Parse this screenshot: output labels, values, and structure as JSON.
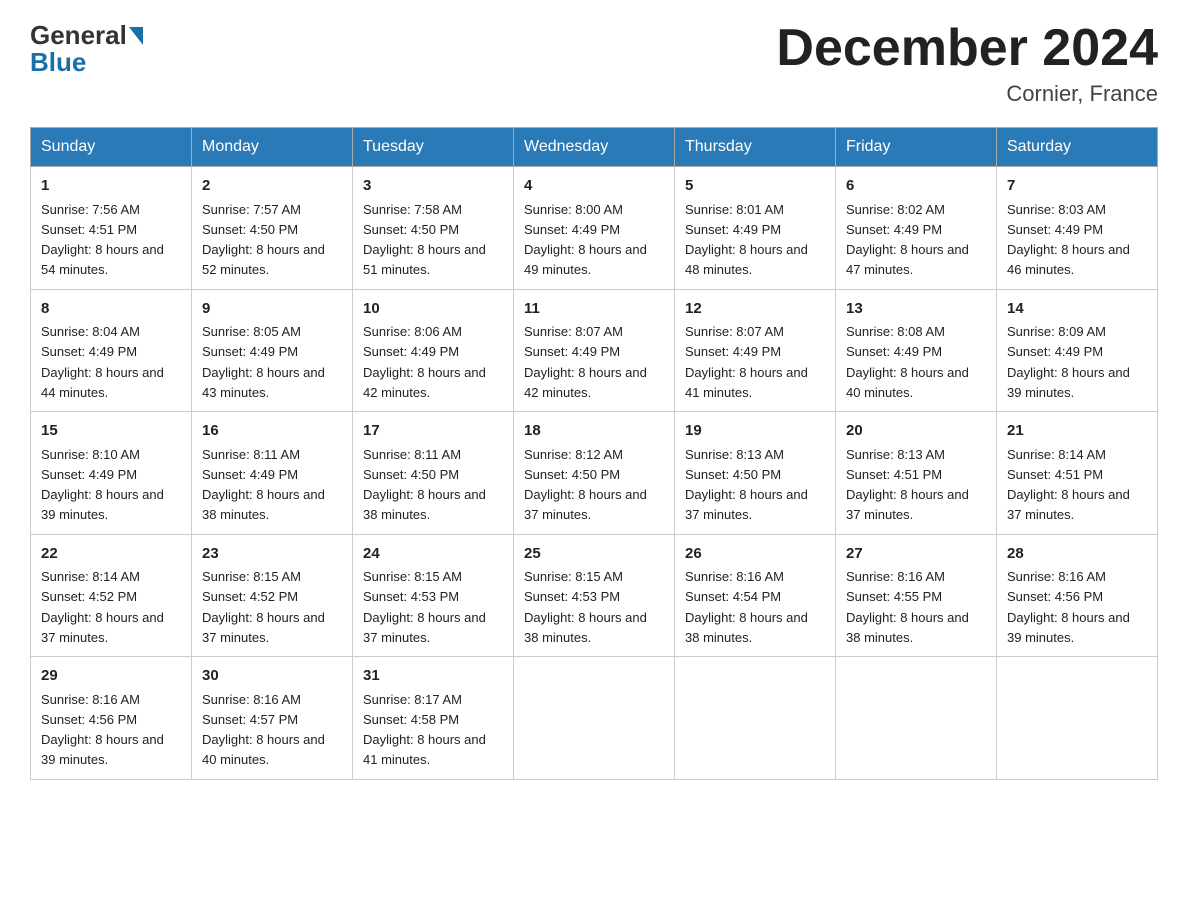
{
  "header": {
    "logo": {
      "general": "General",
      "blue": "Blue"
    },
    "title": "December 2024",
    "location": "Cornier, France"
  },
  "days_of_week": [
    "Sunday",
    "Monday",
    "Tuesday",
    "Wednesday",
    "Thursday",
    "Friday",
    "Saturday"
  ],
  "weeks": [
    [
      {
        "day": "1",
        "sunrise": "7:56 AM",
        "sunset": "4:51 PM",
        "daylight": "8 hours and 54 minutes."
      },
      {
        "day": "2",
        "sunrise": "7:57 AM",
        "sunset": "4:50 PM",
        "daylight": "8 hours and 52 minutes."
      },
      {
        "day": "3",
        "sunrise": "7:58 AM",
        "sunset": "4:50 PM",
        "daylight": "8 hours and 51 minutes."
      },
      {
        "day": "4",
        "sunrise": "8:00 AM",
        "sunset": "4:49 PM",
        "daylight": "8 hours and 49 minutes."
      },
      {
        "day": "5",
        "sunrise": "8:01 AM",
        "sunset": "4:49 PM",
        "daylight": "8 hours and 48 minutes."
      },
      {
        "day": "6",
        "sunrise": "8:02 AM",
        "sunset": "4:49 PM",
        "daylight": "8 hours and 47 minutes."
      },
      {
        "day": "7",
        "sunrise": "8:03 AM",
        "sunset": "4:49 PM",
        "daylight": "8 hours and 46 minutes."
      }
    ],
    [
      {
        "day": "8",
        "sunrise": "8:04 AM",
        "sunset": "4:49 PM",
        "daylight": "8 hours and 44 minutes."
      },
      {
        "day": "9",
        "sunrise": "8:05 AM",
        "sunset": "4:49 PM",
        "daylight": "8 hours and 43 minutes."
      },
      {
        "day": "10",
        "sunrise": "8:06 AM",
        "sunset": "4:49 PM",
        "daylight": "8 hours and 42 minutes."
      },
      {
        "day": "11",
        "sunrise": "8:07 AM",
        "sunset": "4:49 PM",
        "daylight": "8 hours and 42 minutes."
      },
      {
        "day": "12",
        "sunrise": "8:07 AM",
        "sunset": "4:49 PM",
        "daylight": "8 hours and 41 minutes."
      },
      {
        "day": "13",
        "sunrise": "8:08 AM",
        "sunset": "4:49 PM",
        "daylight": "8 hours and 40 minutes."
      },
      {
        "day": "14",
        "sunrise": "8:09 AM",
        "sunset": "4:49 PM",
        "daylight": "8 hours and 39 minutes."
      }
    ],
    [
      {
        "day": "15",
        "sunrise": "8:10 AM",
        "sunset": "4:49 PM",
        "daylight": "8 hours and 39 minutes."
      },
      {
        "day": "16",
        "sunrise": "8:11 AM",
        "sunset": "4:49 PM",
        "daylight": "8 hours and 38 minutes."
      },
      {
        "day": "17",
        "sunrise": "8:11 AM",
        "sunset": "4:50 PM",
        "daylight": "8 hours and 38 minutes."
      },
      {
        "day": "18",
        "sunrise": "8:12 AM",
        "sunset": "4:50 PM",
        "daylight": "8 hours and 37 minutes."
      },
      {
        "day": "19",
        "sunrise": "8:13 AM",
        "sunset": "4:50 PM",
        "daylight": "8 hours and 37 minutes."
      },
      {
        "day": "20",
        "sunrise": "8:13 AM",
        "sunset": "4:51 PM",
        "daylight": "8 hours and 37 minutes."
      },
      {
        "day": "21",
        "sunrise": "8:14 AM",
        "sunset": "4:51 PM",
        "daylight": "8 hours and 37 minutes."
      }
    ],
    [
      {
        "day": "22",
        "sunrise": "8:14 AM",
        "sunset": "4:52 PM",
        "daylight": "8 hours and 37 minutes."
      },
      {
        "day": "23",
        "sunrise": "8:15 AM",
        "sunset": "4:52 PM",
        "daylight": "8 hours and 37 minutes."
      },
      {
        "day": "24",
        "sunrise": "8:15 AM",
        "sunset": "4:53 PM",
        "daylight": "8 hours and 37 minutes."
      },
      {
        "day": "25",
        "sunrise": "8:15 AM",
        "sunset": "4:53 PM",
        "daylight": "8 hours and 38 minutes."
      },
      {
        "day": "26",
        "sunrise": "8:16 AM",
        "sunset": "4:54 PM",
        "daylight": "8 hours and 38 minutes."
      },
      {
        "day": "27",
        "sunrise": "8:16 AM",
        "sunset": "4:55 PM",
        "daylight": "8 hours and 38 minutes."
      },
      {
        "day": "28",
        "sunrise": "8:16 AM",
        "sunset": "4:56 PM",
        "daylight": "8 hours and 39 minutes."
      }
    ],
    [
      {
        "day": "29",
        "sunrise": "8:16 AM",
        "sunset": "4:56 PM",
        "daylight": "8 hours and 39 minutes."
      },
      {
        "day": "30",
        "sunrise": "8:16 AM",
        "sunset": "4:57 PM",
        "daylight": "8 hours and 40 minutes."
      },
      {
        "day": "31",
        "sunrise": "8:17 AM",
        "sunset": "4:58 PM",
        "daylight": "8 hours and 41 minutes."
      },
      null,
      null,
      null,
      null
    ]
  ]
}
